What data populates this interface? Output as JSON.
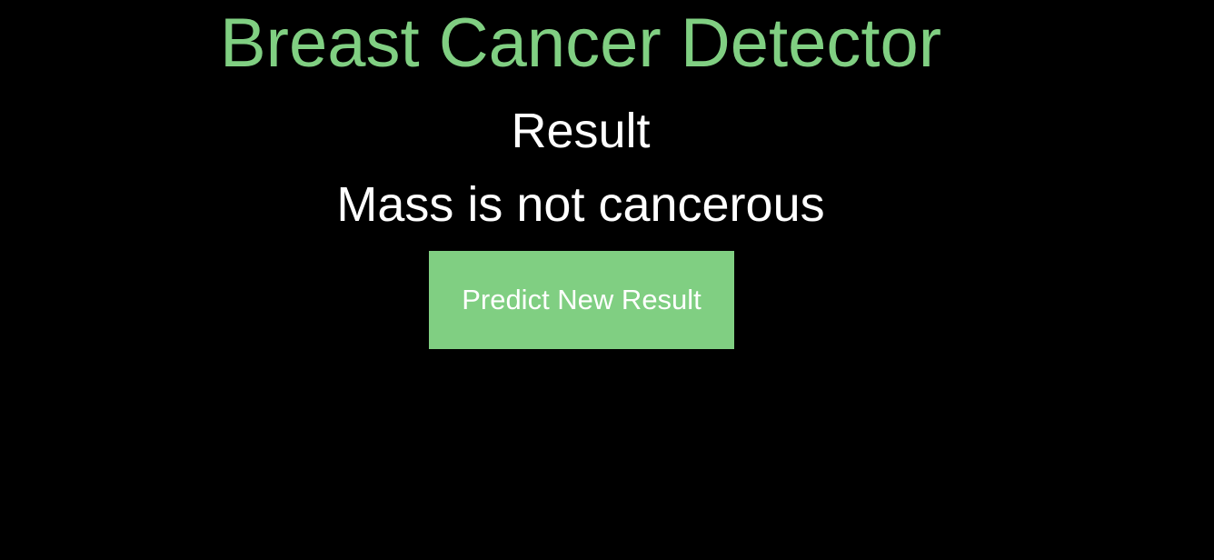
{
  "header": {
    "title": "Breast Cancer Detector"
  },
  "result": {
    "heading": "Result",
    "message": "Mass is not cancerous"
  },
  "actions": {
    "predict_new_label": "Predict New Result"
  },
  "colors": {
    "accent": "#80cf82",
    "background": "#000000",
    "text": "#ffffff"
  }
}
